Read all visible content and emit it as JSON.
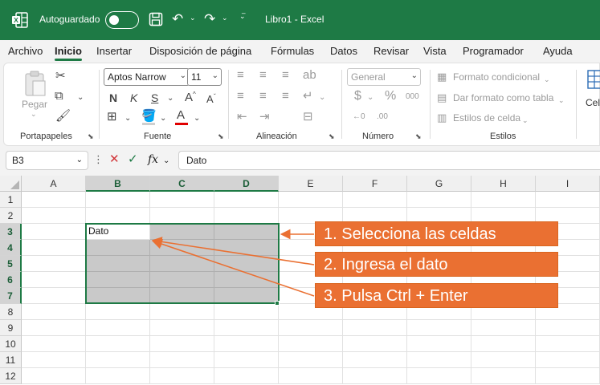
{
  "titlebar": {
    "autosave_label": "Autoguardado",
    "doc_title": "Libro1  -  Excel"
  },
  "tabs": [
    "Archivo",
    "Inicio",
    "Insertar",
    "Disposición de página",
    "Fórmulas",
    "Datos",
    "Revisar",
    "Vista",
    "Programador",
    "Ayuda"
  ],
  "ribbon": {
    "clipboard": {
      "paste_label": "Pegar",
      "group_label": "Portapapeles"
    },
    "font": {
      "font_name": "Aptos Narrow",
      "font_size": "11",
      "bold": "N",
      "italic": "K",
      "underline": "S",
      "grow": "A",
      "shrink": "A",
      "group_label": "Fuente",
      "font_color": "#e00000"
    },
    "alignment": {
      "group_label": "Alineación"
    },
    "number": {
      "format": "General",
      "group_label": "Número"
    },
    "styles": {
      "conditional": "Formato condicional",
      "table": "Dar formato como tabla",
      "cell_styles": "Estilos de celda",
      "group_label": "Estilos"
    },
    "cells": {
      "label": "Cel"
    }
  },
  "formula_bar": {
    "name_box": "B3",
    "fx": "fx",
    "content": "Dato"
  },
  "grid": {
    "columns": [
      "A",
      "B",
      "C",
      "D",
      "E",
      "F",
      "G",
      "H",
      "I"
    ],
    "rows": [
      "1",
      "2",
      "3",
      "4",
      "5",
      "6",
      "7",
      "8",
      "9",
      "10",
      "11",
      "12"
    ],
    "active_cell_text": "Dato"
  },
  "callouts": [
    "1. Selecciona las celdas",
    "2. Ingresa el dato",
    "3. Pulsa Ctrl + Enter"
  ],
  "colors": {
    "accent": "#1e7a45",
    "callout": "#ea7032"
  }
}
